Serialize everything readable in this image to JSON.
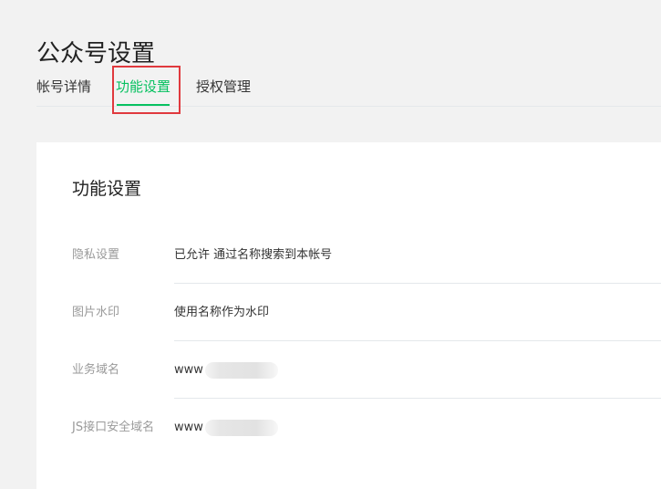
{
  "page": {
    "title": "公众号设置"
  },
  "tabs": [
    {
      "label": "帐号详情",
      "active": false
    },
    {
      "label": "功能设置",
      "active": true
    },
    {
      "label": "授权管理",
      "active": false
    }
  ],
  "card": {
    "title": "功能设置",
    "rows": [
      {
        "label": "隐私设置",
        "value": "已允许 通过名称搜索到本帐号"
      },
      {
        "label": "图片水印",
        "value": "使用名称作为水印"
      },
      {
        "label": "业务域名",
        "value": "www"
      },
      {
        "label": "JS接口安全域名",
        "value": "www"
      }
    ]
  },
  "colors": {
    "accent": "#07c160",
    "highlight": "#e0393e"
  }
}
